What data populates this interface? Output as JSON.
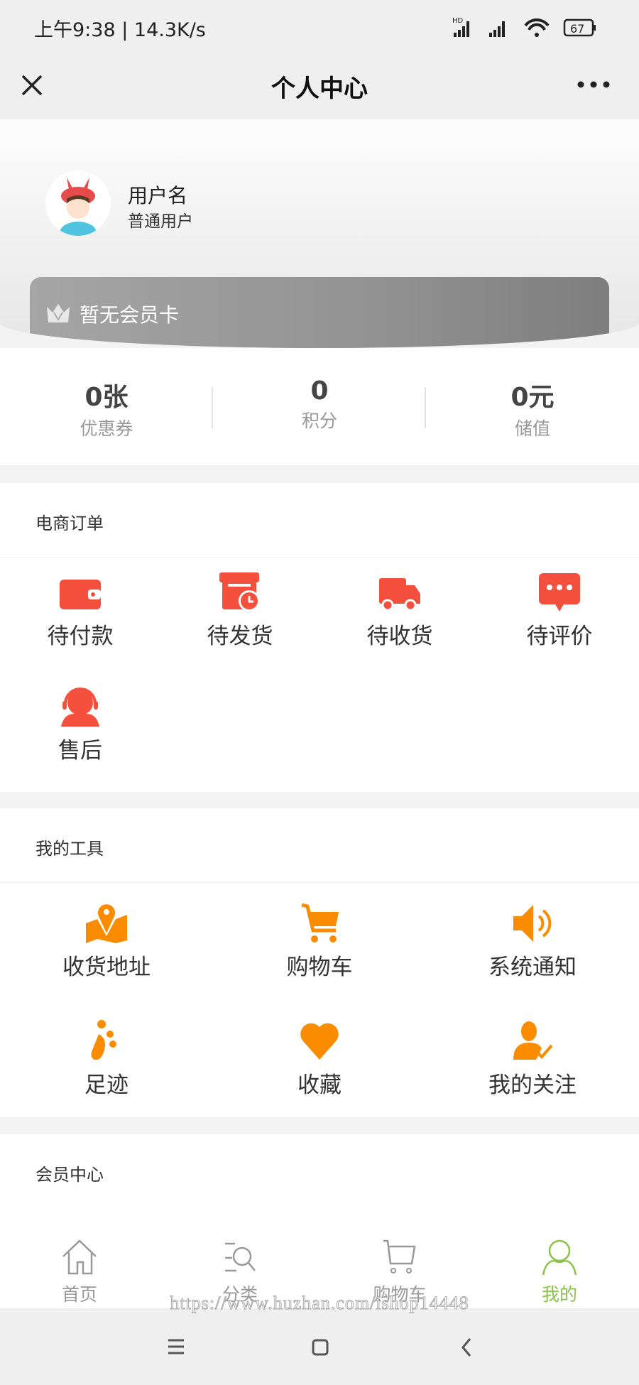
{
  "status_bar": {
    "time": "上午9:38 | 14.3K/s",
    "battery": "67",
    "network": "HD"
  },
  "header": {
    "title": "个人中心",
    "close_icon": "close-icon",
    "more_icon": "more-icon"
  },
  "profile": {
    "username": "用户名",
    "role": "普通用户",
    "card_text": "暂无会员卡"
  },
  "stats": [
    {
      "value": "0张",
      "label": "优惠券"
    },
    {
      "value": "0",
      "label": "积分"
    },
    {
      "value": "0元",
      "label": "储值"
    }
  ],
  "orders": {
    "title": "电商订单",
    "items": [
      {
        "label": "待付款",
        "icon": "wallet-icon"
      },
      {
        "label": "待发货",
        "icon": "package-clock-icon"
      },
      {
        "label": "待收货",
        "icon": "truck-icon"
      },
      {
        "label": "待评价",
        "icon": "comment-icon"
      },
      {
        "label": "售后",
        "icon": "customer-service-icon"
      }
    ]
  },
  "tools": {
    "title": "我的工具",
    "items": [
      {
        "label": "收货地址",
        "icon": "map-pin-icon"
      },
      {
        "label": "购物车",
        "icon": "cart-icon"
      },
      {
        "label": "系统通知",
        "icon": "speaker-icon"
      },
      {
        "label": "足迹",
        "icon": "footprint-icon"
      },
      {
        "label": "收藏",
        "icon": "heart-icon"
      },
      {
        "label": "我的关注",
        "icon": "user-check-icon"
      }
    ]
  },
  "member": {
    "title": "会员中心"
  },
  "tabbar": [
    {
      "label": "首页",
      "icon": "home-icon"
    },
    {
      "label": "分类",
      "icon": "category-search-icon"
    },
    {
      "label": "购物车",
      "icon": "cart-outline-icon"
    },
    {
      "label": "我的",
      "icon": "user-icon",
      "active": true
    }
  ],
  "watermark": "https://www.huzhan.com/ishop14448",
  "colors": {
    "order_icon": "#f5503e",
    "tool_icon": "#fb8c00",
    "tab_active": "#8bc34a",
    "tab_inactive": "#999999"
  }
}
